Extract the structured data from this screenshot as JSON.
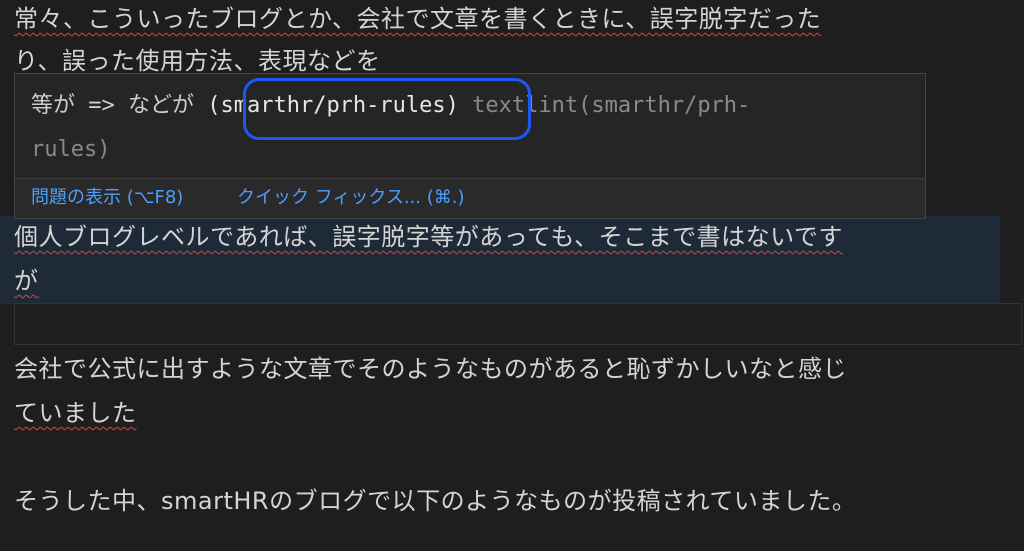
{
  "editor": {
    "lines": [
      "常々、こういったブログとか、会社で文章を書くときに、誤字脱字だった",
      "り、誤った使用方法、表現などを",
      "個人ブログレベルであれば、誤字脱字等があっても、そこまで書はないです",
      "が",
      "",
      "会社で公式に出すような文章でそのようなものがあると恥ずかしいなと感じ",
      "ていました",
      "",
      "そうした中、smartHRのブログで以下のようなものが投稿されていました。"
    ]
  },
  "hover": {
    "message_prefix": "等が => などが ",
    "rule_source": "(smarthr/prh-rules)",
    "tool_line1": " textlint(smarthr/prh-",
    "tool_line2": "rules)",
    "actions": {
      "view_problem": "問題の表示 (⌥F8)",
      "quick_fix": "クイック フィックス... (⌘.)"
    }
  },
  "colors": {
    "background": "#1e1e1e",
    "text": "#d4d4d4",
    "squiggle": "#e0443c",
    "link": "#4b9eff",
    "annotation": "#1f57f5"
  }
}
